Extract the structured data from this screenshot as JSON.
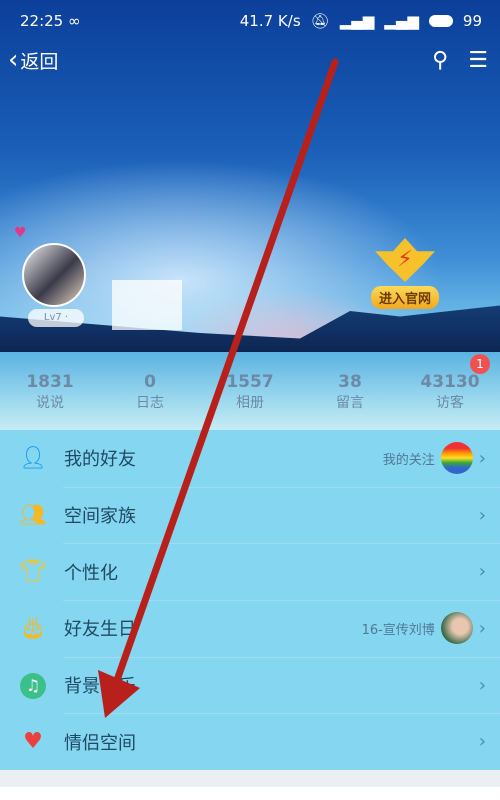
{
  "status_bar": {
    "time": "22:25",
    "loop_icon": "∞",
    "speed": "41.7 K/s",
    "battery": "99"
  },
  "nav": {
    "back_label": "返回",
    "search_icon": "search-icon",
    "menu_icon": "menu-icon"
  },
  "profile": {
    "level_label": "Lv7 ·  ",
    "official_label": "进入官网"
  },
  "stats": [
    {
      "value": "1831",
      "label": "说说"
    },
    {
      "value": "0",
      "label": "日志"
    },
    {
      "value": "1557",
      "label": "相册"
    },
    {
      "value": "38",
      "label": "留言"
    },
    {
      "value": "43130",
      "label": "访客",
      "badge": "1"
    }
  ],
  "menu": [
    {
      "label": "我的好友",
      "sub": "我的关注",
      "icon": "person-icon",
      "color": "#1a9ae8"
    },
    {
      "label": "空间家族",
      "sub": "",
      "icon": "group-icon",
      "color": "#f7b825"
    },
    {
      "label": "个性化",
      "sub": "",
      "icon": "shirt-icon",
      "color": "#f7c325"
    },
    {
      "label": "好友生日",
      "sub": "16-宣传刘博",
      "icon": "cake-icon",
      "color": "#f7b825"
    },
    {
      "label": "背景音乐",
      "sub": "",
      "icon": "music-icon",
      "color": "#3cc08a"
    },
    {
      "label": "情侣空间",
      "sub": "",
      "icon": "heart-icon",
      "color": "#ea4040"
    }
  ],
  "annotation": {
    "arrow_color": "#b8211b"
  }
}
